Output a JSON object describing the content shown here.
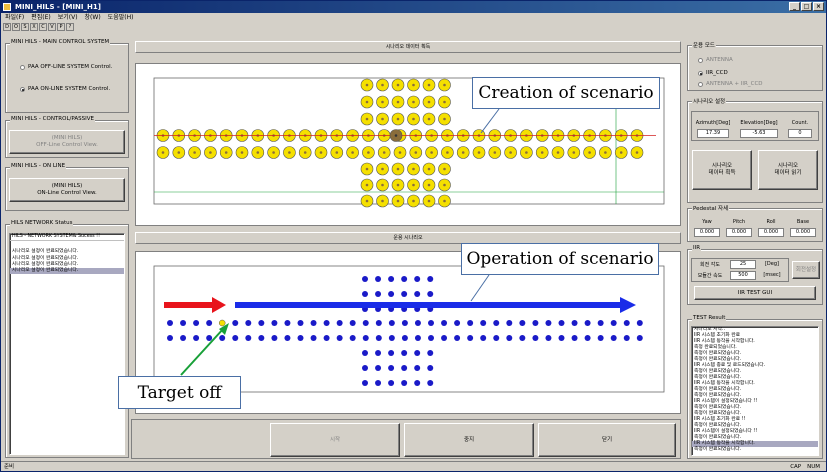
{
  "window": {
    "title": "MINI_HILS - [MINI_H1]",
    "min": "_",
    "max": "□",
    "close": "×"
  },
  "menu": [
    "파일(F)",
    "편집(E)",
    "보기(V)",
    "창(W)",
    "도움말(H)"
  ],
  "toolbar": [
    "D",
    "O",
    "S",
    "X",
    "C",
    "V",
    "P",
    "?"
  ],
  "left": {
    "main_control": {
      "title": "MINI HILS - MAIN CONTROL SYSTEM",
      "opt_offline": "PAA OFF-LINE SYSTEM Control.",
      "opt_online": "PAA ON-LINE SYSTEM Control."
    },
    "control_passive": {
      "title": "MINI HILS - CONTROL/PASSIVE",
      "button_line1": "(MINI HILS)",
      "button_line2": "OFF-Line Control View."
    },
    "on_line": {
      "title": "MINI HILS - ON LINE",
      "button_line1": "(MINI HILS)",
      "button_line2": "ON-Line Control View."
    },
    "network": {
      "title": "HILS NETWORK Status",
      "header": "HILS - NETWORK SYSTEM& Sucess !!",
      "lines": [
        "시나리오 설정이 완료되었습니다.",
        "시나리오 설정이 완료되었습니다.",
        "시나리오 설정이 완료되었습니다.",
        "시나리오 설정이 완료되었습니다."
      ]
    }
  },
  "center": {
    "top_strip": "시나리오 데이터 획득",
    "mid_strip": "운용 시나리오",
    "btn_start": "시작",
    "btn_stop": "중지",
    "btn_close": "닫기"
  },
  "annotations": {
    "creation": "Creation of scenario",
    "operation": "Operation of scenario",
    "target_off": "Target off"
  },
  "right": {
    "mode": {
      "title": "운용 모드",
      "opt1": "ANTENNA",
      "opt2": "IIR_CCD",
      "opt3": "ANTENNA + IIR_CCD"
    },
    "scenario": {
      "title": "시나리오 설정",
      "col_az": "Azimuth[Deg]",
      "col_el": "Elevation[Deg]",
      "col_count": "Count.",
      "val_az": "17.39",
      "val_el": "-5.63",
      "val_count": "0",
      "btn_acquire_1": "시나리오",
      "btn_acquire_2": "데이터 획득",
      "btn_read_1": "시나리오",
      "btn_read_2": "데이터 읽기"
    },
    "pedestal": {
      "title": "Pedestal 자세",
      "yaw": "Yaw",
      "pitch": "Pitch",
      "roll": "Roll",
      "base": "Base",
      "yaw_v": "0.000",
      "pitch_v": "0.000",
      "roll_v": "0.000",
      "base_v": "0.000"
    },
    "ir": {
      "title": "IIR",
      "lbl_angle": "회전 각도",
      "val_angle": "25",
      "unit_angle": "[Deg]",
      "lbl_speed": "모듈간 속도",
      "val_speed": "500",
      "unit_speed": "[msec]",
      "btn_side": "회전설정",
      "btn_test": "IIR TEST GUI"
    },
    "test": {
      "title": "TEST Result",
      "lines": [
        "시나리오 시작..",
        "IIR 시스템 초기화 완료",
        "IIR 시스템 동작을 시작합니다.",
        "측정 완료되었습니다.",
        "측정이 완료되었습니다.",
        "측정이 완료되었습니다.",
        "IIR 시스템 종료 및 로드되었습니다.",
        "측정이 완료되었습니다.",
        "측정이 완료되었습니다.",
        "IIR 시스템 동작을 시작합니다.",
        "측정이 완료되었습니다.",
        "측정이 완료되었습니다.",
        "IIR 시스템이 설정되었습니다 !!",
        "측정이 완료되었습니다.",
        "측정이 완료되었습니다.",
        "IIR 시스템 초기화 완료 !!",
        "측정이 완료되었습니다.",
        "IIR 시스템이 설정되었습니다 !!",
        "측정이 완료되었습니다.",
        "IIR 시스템 동작을 시작합니다.",
        "측정이 완료되었습니다."
      ]
    }
  },
  "status": {
    "left": "준비",
    "caps": "CAP",
    "num": "NUM"
  },
  "colors": {
    "marker_fill": "#f5e000",
    "marker_dot": "#8a6d3b",
    "op_dot": "#1a1ac8",
    "arrow_red": "#e8141c",
    "arrow_blue": "#1a2ce8",
    "accent_green": "#18a038"
  }
}
